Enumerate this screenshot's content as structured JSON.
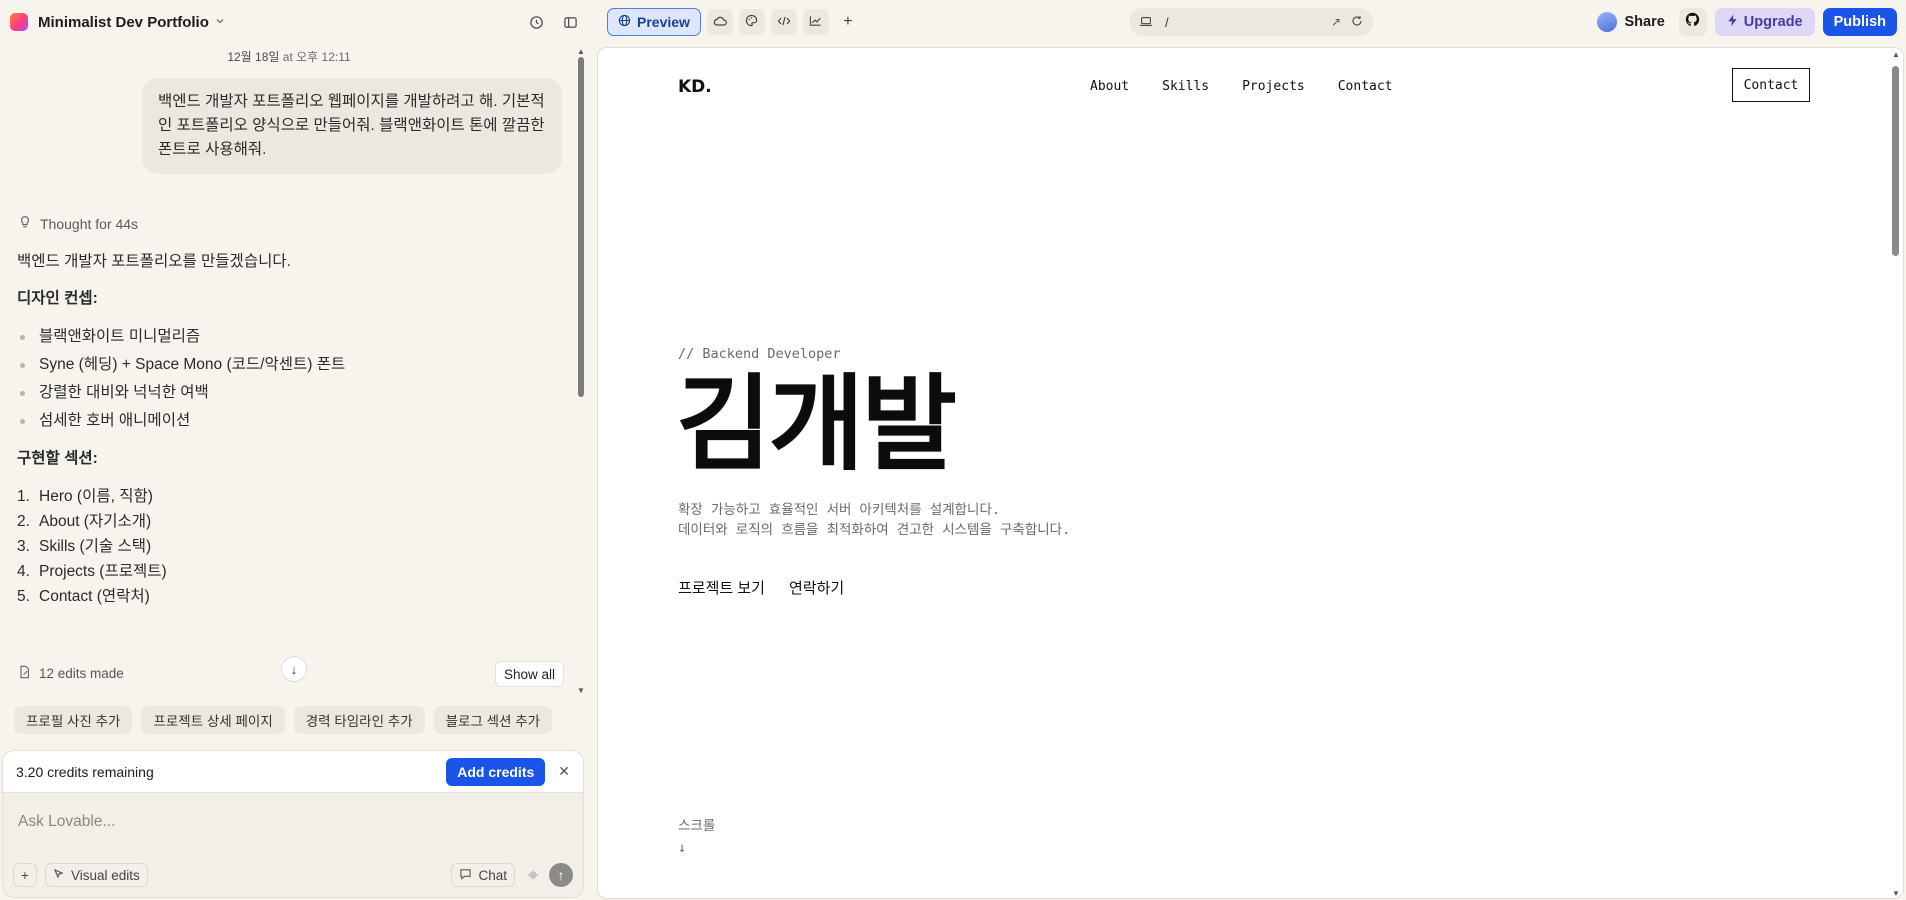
{
  "project": {
    "title": "Minimalist Dev Portfolio"
  },
  "chat": {
    "timestamp_date": "12월 18일",
    "timestamp_time": "at 오후 12:11",
    "user_message": "백엔드 개발자 포트폴리오 웹페이지를 개발하려고 해. 기본적인 포트폴리오 양식으로 만들어줘. 블랙앤화이트 톤에 깔끔한 폰트로 사용해줘.",
    "thought": "Thought for 44s",
    "intro": "백엔드 개발자 포트폴리오를 만들겠습니다.",
    "design_heading": "디자인 컨셉:",
    "design_items": [
      "블랙앤화이트 미니멀리즘",
      "Syne (헤딩) + Space Mono (코드/악센트) 폰트",
      "강렬한 대비와 넉넉한 여백",
      "섬세한 호버 애니메이션"
    ],
    "sections_heading": "구현할 섹션:",
    "sections": [
      {
        "n": "1.",
        "label": "Hero (이름, 직함)"
      },
      {
        "n": "2.",
        "label": "About (자기소개)"
      },
      {
        "n": "3.",
        "label": "Skills (기술 스택)"
      },
      {
        "n": "4.",
        "label": "Projects (프로젝트)"
      },
      {
        "n": "5.",
        "label": "Contact (연락처)"
      }
    ],
    "edits": "12 edits made",
    "show_all": "Show all",
    "suggestions": [
      "프로필 사진 추가",
      "프로젝트 상세 페이지",
      "경력 타임라인 추가",
      "블로그 섹션 추가"
    ],
    "credits": "3.20 credits remaining",
    "add_credits": "Add credits",
    "placeholder": "Ask Lovable...",
    "visual_edits": "Visual edits",
    "chat_btn": "Chat"
  },
  "toolbar": {
    "preview": "Preview",
    "url_path": "/",
    "share": "Share",
    "upgrade": "Upgrade",
    "publish": "Publish"
  },
  "site": {
    "brand": "KD.",
    "nav": [
      "About",
      "Skills",
      "Projects",
      "Contact"
    ],
    "nav_cta": "Contact",
    "tag": "// Backend Developer",
    "name": "김개발",
    "desc1": "확장 가능하고 효율적인 서버 아키텍처를 설계합니다.",
    "desc2": "데이터와 로직의 흐름을 최적화하여 견고한 시스템을 구축합니다.",
    "link1": "프로젝트 보기",
    "link2": "연락하기",
    "scroll": "스크롤",
    "scroll_arrow": "↓"
  },
  "colors": {
    "accent": "#1a54e8",
    "upgrade_bg": "#ded8f6",
    "page_bg": "#f7f4ee"
  },
  "icons": [
    "history-icon",
    "sidebar-icon",
    "globe-icon",
    "cloud-icon",
    "palette-icon",
    "code-icon",
    "chart-icon",
    "plus-icon",
    "laptop-icon",
    "external-link-icon",
    "refresh-icon",
    "github-icon",
    "bolt-icon",
    "lightbulb-icon",
    "file-edit-icon",
    "arrow-down-icon",
    "close-icon",
    "pointer-icon",
    "chat-icon",
    "mic-icon",
    "send-icon"
  ]
}
